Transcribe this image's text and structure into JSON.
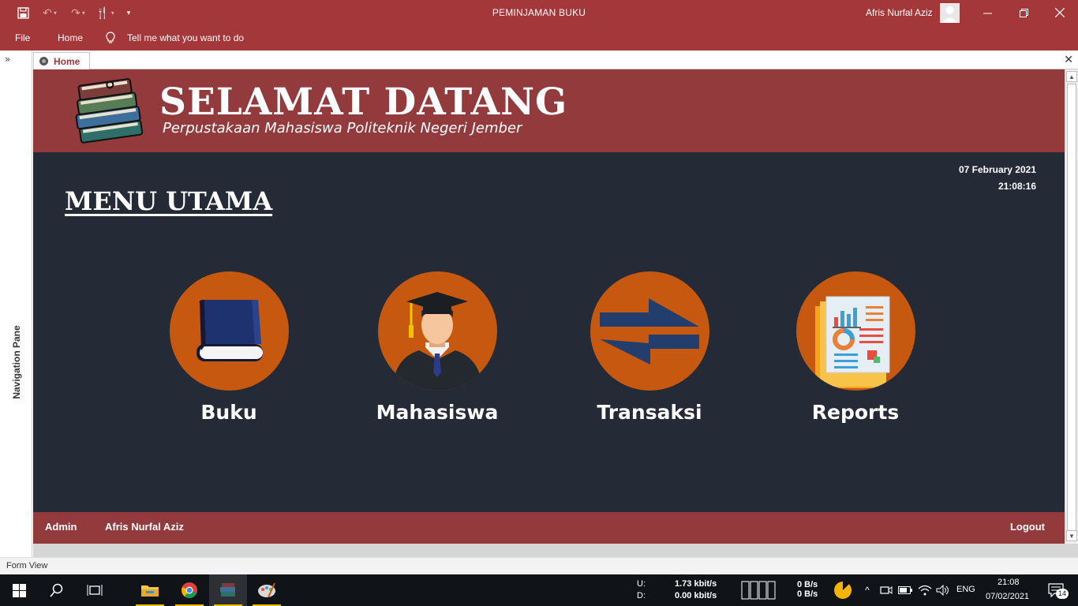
{
  "window": {
    "title": "PEMINJAMAN BUKU",
    "user": "Afris Nurfal Aziz"
  },
  "ribbon": {
    "file": "File",
    "home": "Home",
    "tell_me": "Tell me what you want to do"
  },
  "nav_pane": {
    "label": "Navigation Pane"
  },
  "doc_tab": {
    "label": "Home"
  },
  "header": {
    "title": "SELAMAT DATANG",
    "subtitle": "Perpustakaan Mahasiswa Politeknik Negeri Jember"
  },
  "datetime": {
    "date": "07 February 2021",
    "time": "21:08:16"
  },
  "menu": {
    "title": "MENU UTAMA",
    "items": [
      {
        "label": "Buku",
        "icon": "book-icon"
      },
      {
        "label": "Mahasiswa",
        "icon": "graduate-icon"
      },
      {
        "label": "Transaksi",
        "icon": "exchange-arrows-icon"
      },
      {
        "label": "Reports",
        "icon": "report-icon"
      }
    ]
  },
  "footer": {
    "role": "Admin",
    "user": "Afris Nurfal Aziz",
    "logout": "Logout"
  },
  "statusbar": {
    "view": "Form View"
  },
  "taskbar": {
    "upload_label": "U:",
    "download_label": "D:",
    "upload_speed": "1.73 kbit/s",
    "download_speed": "0.00 kbit/s",
    "disk_read": "0 B/s",
    "disk_write": "0 B/s",
    "language": "ENG",
    "clock_time": "21:08",
    "clock_date": "07/02/2021",
    "notifications": "14"
  },
  "colors": {
    "titlebar": "#a4373a",
    "header": "#923a3c",
    "form_bg": "#242a36",
    "circle": "#c6590f"
  }
}
